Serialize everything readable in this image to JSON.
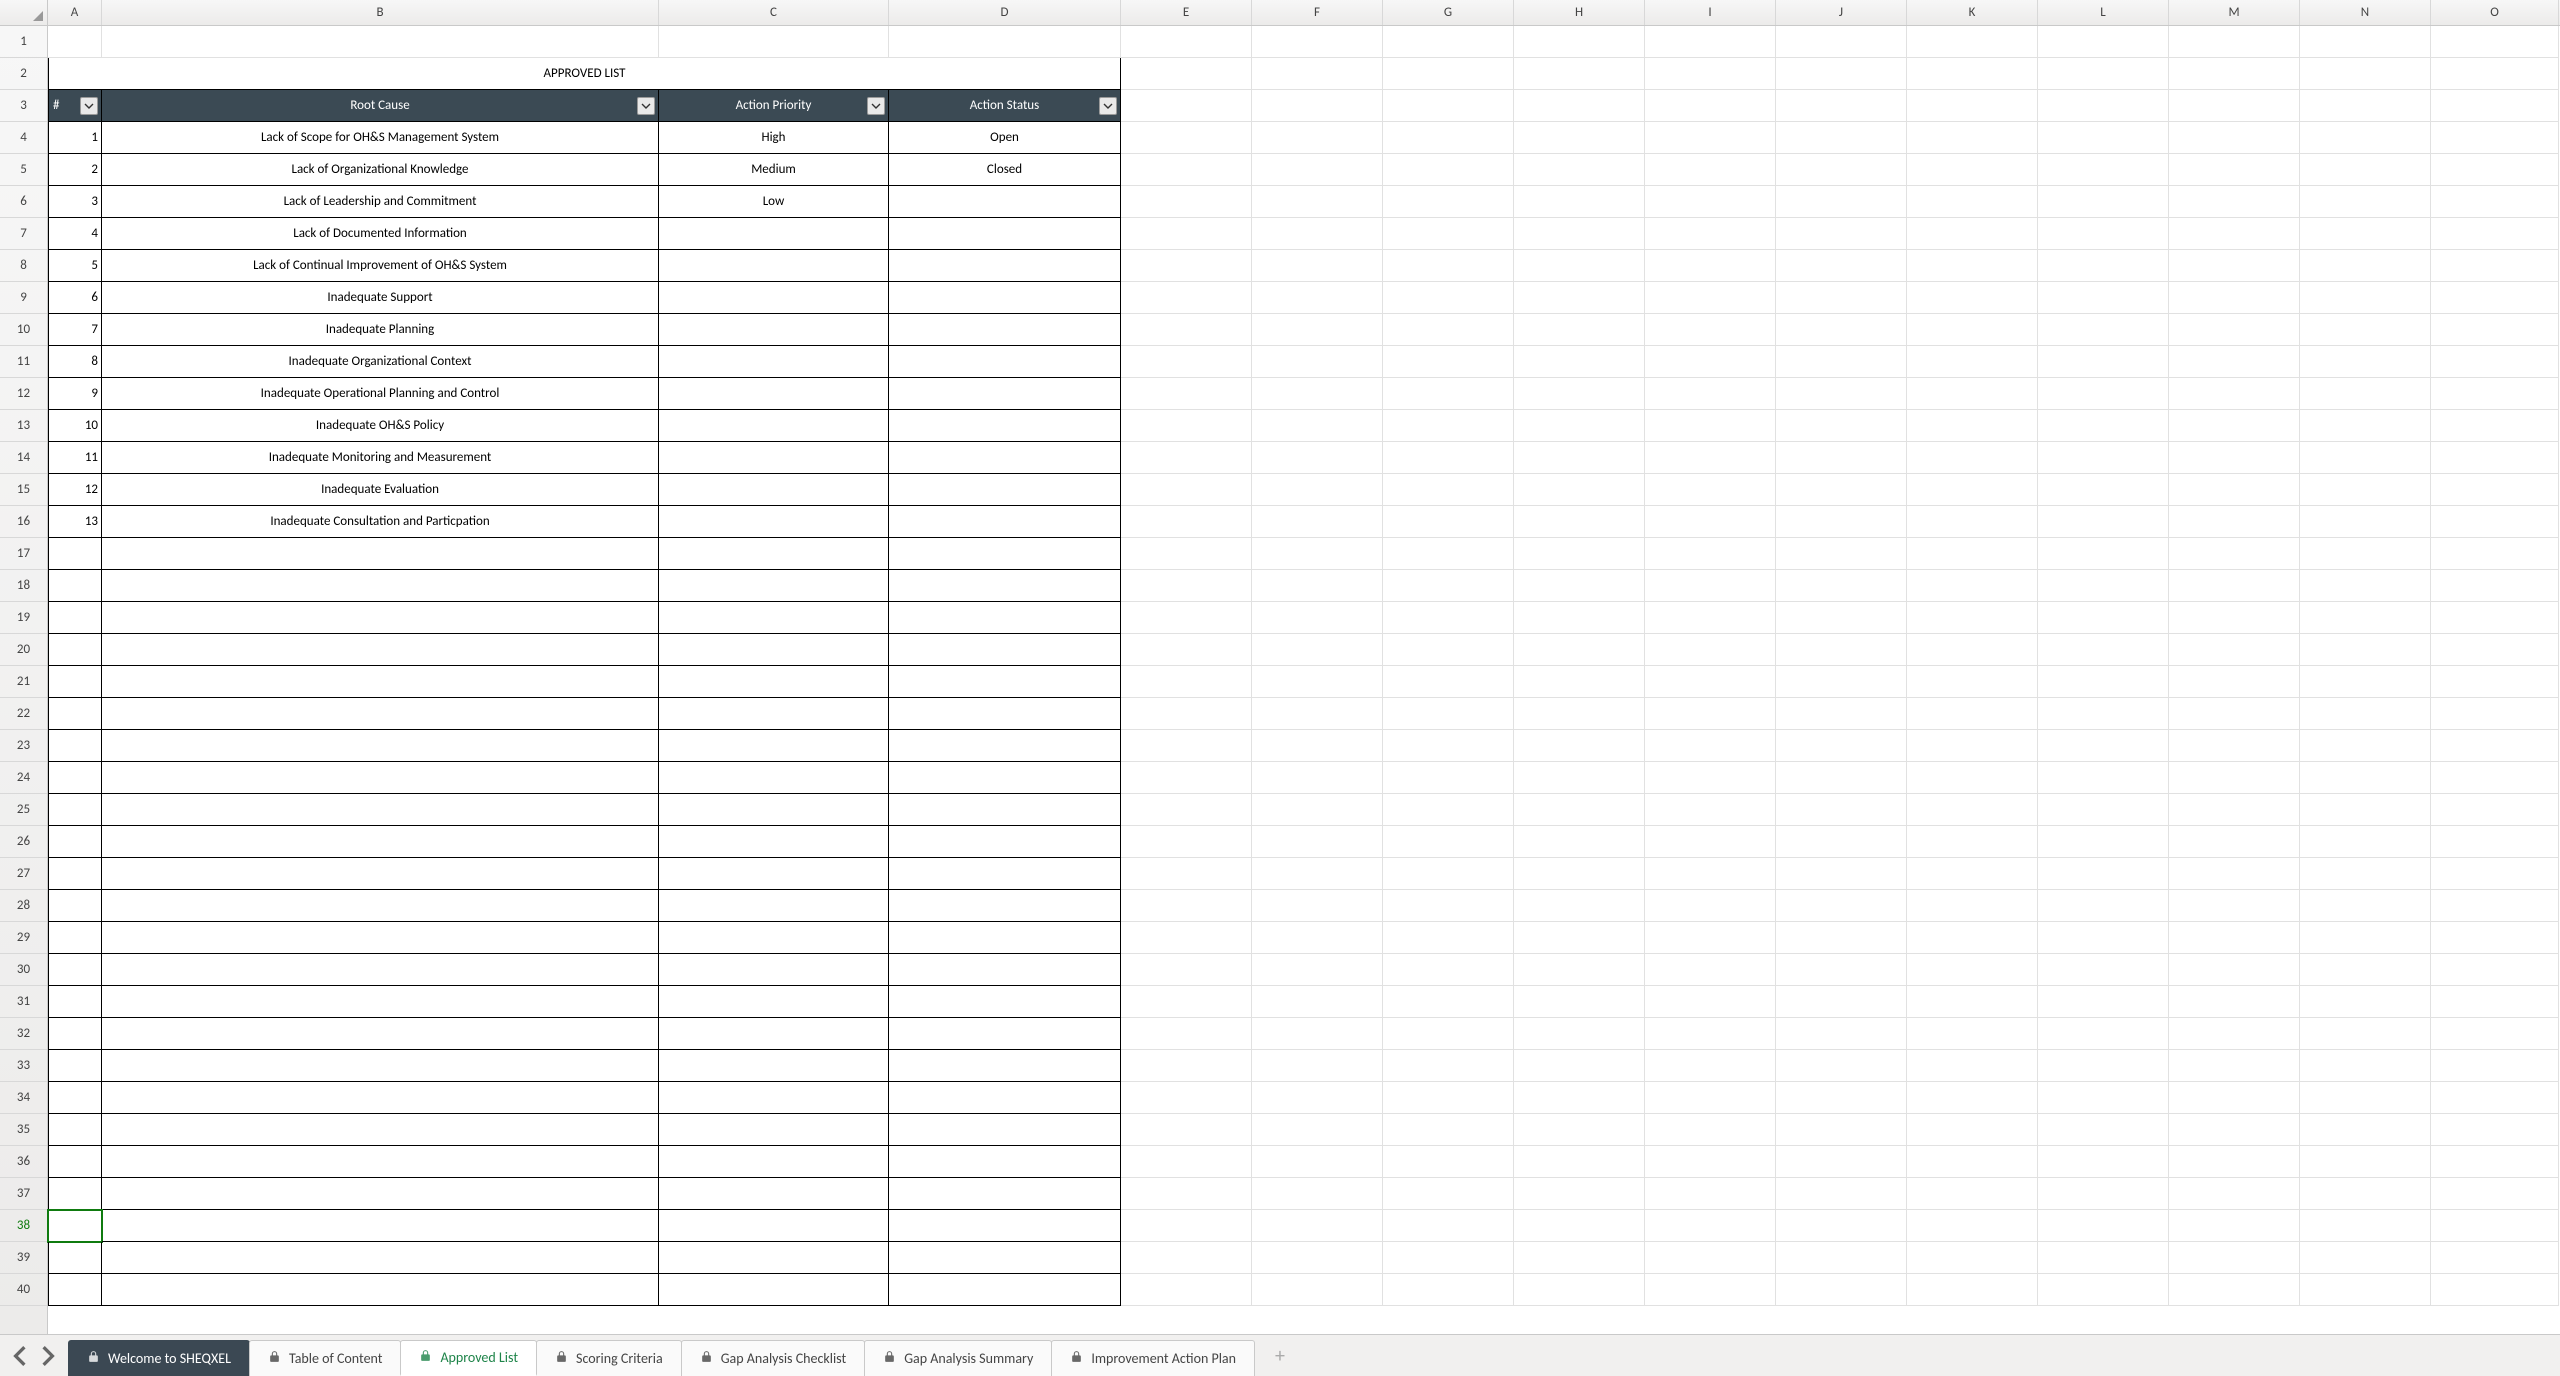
{
  "columns": [
    "A",
    "B",
    "C",
    "D",
    "E",
    "F",
    "G",
    "H",
    "I",
    "J",
    "K",
    "L",
    "M",
    "N",
    "O"
  ],
  "rowCount": 40,
  "activeRow": 38,
  "title": "APPROVED LIST",
  "headers": {
    "num": "#",
    "rootCause": "Root Cause",
    "priority": "Action Priority",
    "status": "Action Status"
  },
  "rows": [
    {
      "n": 1,
      "root": "Lack of Scope for OH&S Management System",
      "pri": "High",
      "stat": "Open"
    },
    {
      "n": 2,
      "root": "Lack of Organizational Knowledge",
      "pri": "Medium",
      "stat": "Closed"
    },
    {
      "n": 3,
      "root": "Lack of Leadership and Commitment",
      "pri": "Low",
      "stat": ""
    },
    {
      "n": 4,
      "root": "Lack of Documented Information",
      "pri": "",
      "stat": ""
    },
    {
      "n": 5,
      "root": "Lack of Continual Improvement of OH&S System",
      "pri": "",
      "stat": ""
    },
    {
      "n": 6,
      "root": "Inadequate Support",
      "pri": "",
      "stat": ""
    },
    {
      "n": 7,
      "root": "Inadequate Planning",
      "pri": "",
      "stat": ""
    },
    {
      "n": 8,
      "root": "Inadequate Organizational Context",
      "pri": "",
      "stat": ""
    },
    {
      "n": 9,
      "root": "Inadequate Operational Planning and Control",
      "pri": "",
      "stat": ""
    },
    {
      "n": 10,
      "root": "Inadequate OH&S Policy",
      "pri": "",
      "stat": ""
    },
    {
      "n": 11,
      "root": "Inadequate Monitoring and Measurement",
      "pri": "",
      "stat": ""
    },
    {
      "n": 12,
      "root": "Inadequate Evaluation",
      "pri": "",
      "stat": ""
    },
    {
      "n": 13,
      "root": "Inadequate Consultation and Particpation",
      "pri": "",
      "stat": ""
    }
  ],
  "emptyDataRows": 24,
  "tabs": [
    {
      "label": "Welcome to SHEQXEL",
      "dark": true
    },
    {
      "label": "Table of Content"
    },
    {
      "label": "Approved List",
      "active": true
    },
    {
      "label": "Scoring Criteria"
    },
    {
      "label": "Gap Analysis Checklist"
    },
    {
      "label": "Gap Analysis Summary"
    },
    {
      "label": "Improvement Action Plan"
    }
  ]
}
